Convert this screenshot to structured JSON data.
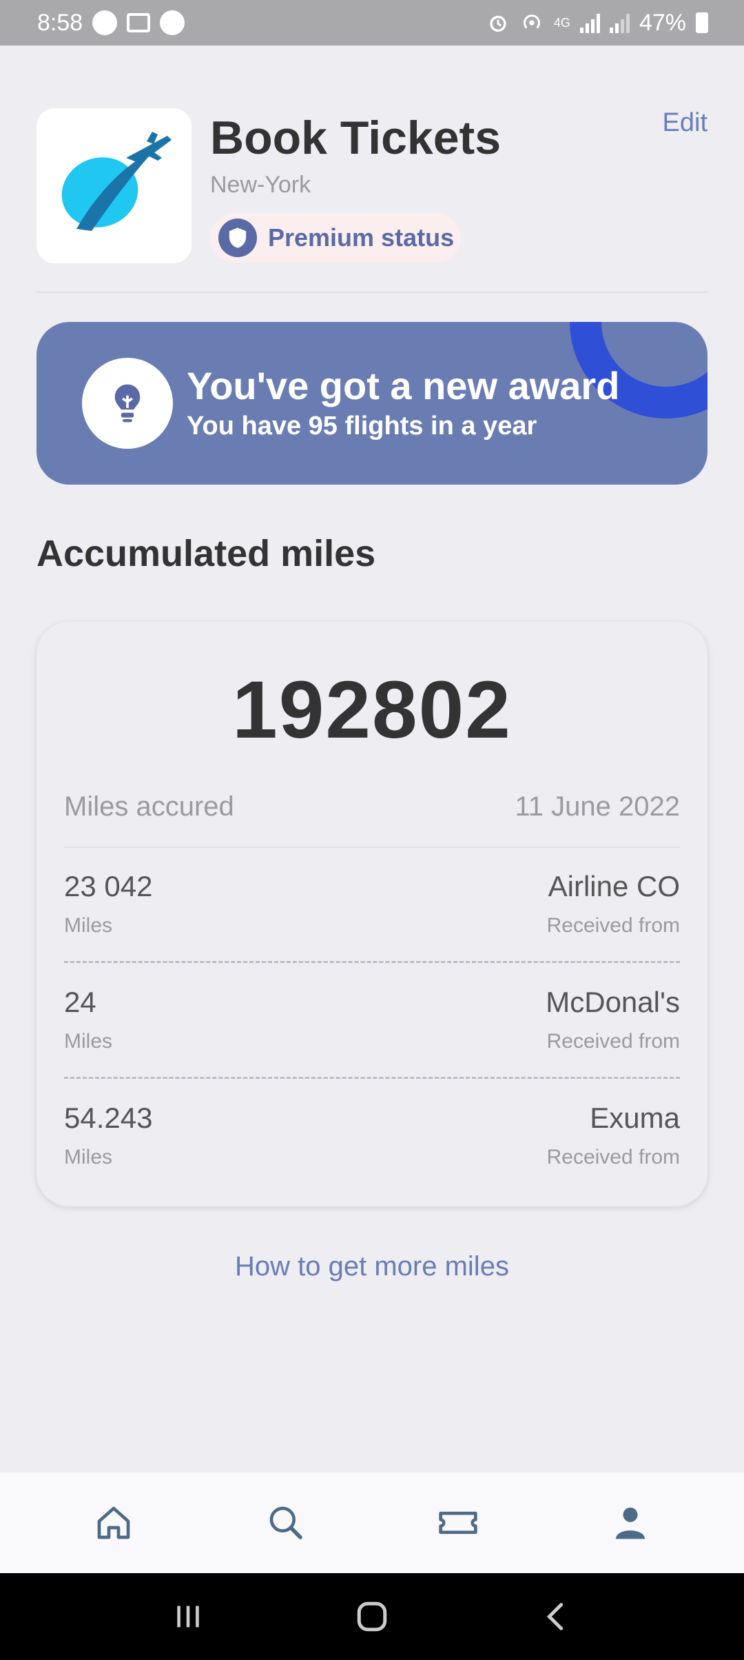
{
  "status_bar": {
    "time": "8:58",
    "battery": "47%",
    "network": "4G"
  },
  "header": {
    "title": "Book Tickets",
    "city": "New-York",
    "badge": "Premium status",
    "edit_label": "Edit",
    "logo_icon": "airplane-logo-icon"
  },
  "award": {
    "title": "You've got a new award",
    "subtitle": "You have 95 flights in a year",
    "icon": "lightbulb-icon"
  },
  "miles": {
    "section_title": "Accumulated miles",
    "total": "192802",
    "accrued_label": "Miles accured",
    "accrued_date": "11 June 2022",
    "entries": [
      {
        "value": "23 042",
        "unit": "Miles",
        "source": "Airline CO",
        "received": "Received from"
      },
      {
        "value": "24",
        "unit": "Miles",
        "source": "McDonal's",
        "received": "Received from"
      },
      {
        "value": "54.243",
        "unit": "Miles",
        "source": "Exuma",
        "received": "Received from"
      }
    ],
    "more_link": "How to get more miles"
  },
  "bottom_nav": {
    "items": [
      "home-icon",
      "search-icon",
      "ticket-icon",
      "profile-icon"
    ],
    "active_index": 3
  },
  "colors": {
    "accent": "#6a7db3",
    "award_deco": "#2f4fd6",
    "background": "#ededf2"
  }
}
